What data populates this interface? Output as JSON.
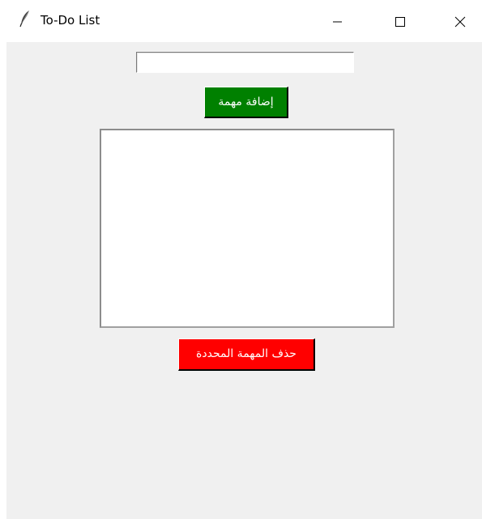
{
  "window": {
    "title": "To-Do List",
    "icon": "feather-icon",
    "controls": [
      "minimize-icon",
      "maximize-icon",
      "close-icon"
    ]
  },
  "task_input": {
    "value": "",
    "placeholder": ""
  },
  "add_button": {
    "label": "إضافة مهمة",
    "color": "#008000"
  },
  "task_list": {
    "items": []
  },
  "delete_button": {
    "label": "حذف المهمة المحددة",
    "color": "#ff0000"
  },
  "colors": {
    "client_background": "#f0f0f0",
    "titlebar_background": "#ffffff"
  }
}
